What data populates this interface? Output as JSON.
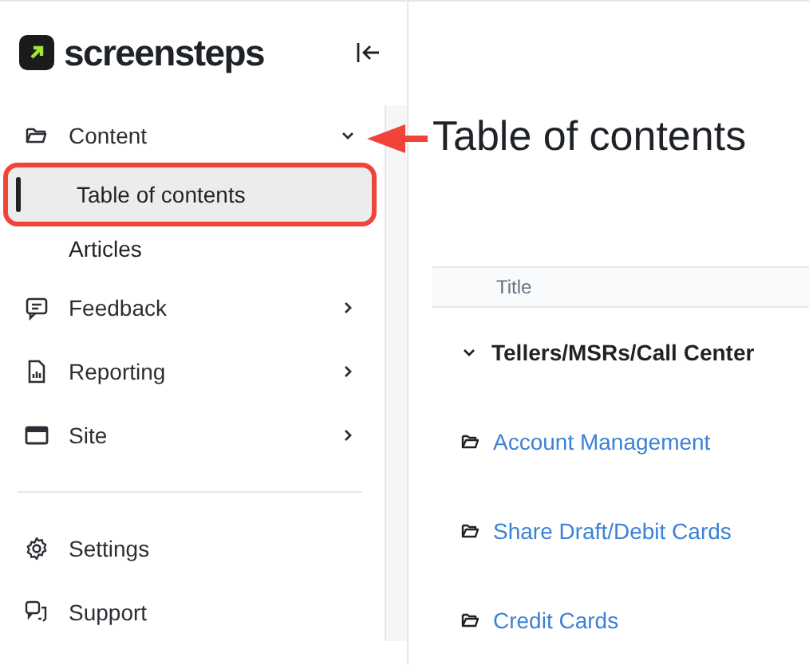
{
  "brand": {
    "name": "screensteps"
  },
  "sidebar": {
    "items": [
      {
        "kind": "group",
        "label": "Content",
        "expanded": true,
        "children": [
          {
            "label": "Table of contents",
            "selected": true
          },
          {
            "label": "Articles",
            "selected": false
          }
        ]
      },
      {
        "kind": "group",
        "label": "Feedback",
        "expanded": false
      },
      {
        "kind": "group",
        "label": "Reporting",
        "expanded": false
      },
      {
        "kind": "group",
        "label": "Site",
        "expanded": false
      },
      {
        "kind": "divider"
      },
      {
        "kind": "link",
        "label": "Settings"
      },
      {
        "kind": "link",
        "label": "Support"
      }
    ]
  },
  "main": {
    "title": "Table of contents",
    "table": {
      "columns": [
        "Title"
      ],
      "rows": [
        {
          "kind": "section",
          "title": "Tellers/MSRs/Call Center",
          "expanded": true
        },
        {
          "kind": "folder",
          "title": "Account Management"
        },
        {
          "kind": "folder",
          "title": "Share Draft/Debit Cards"
        },
        {
          "kind": "folder",
          "title": "Credit Cards"
        }
      ]
    }
  },
  "annotations": {
    "arrow": true,
    "outline": true
  }
}
